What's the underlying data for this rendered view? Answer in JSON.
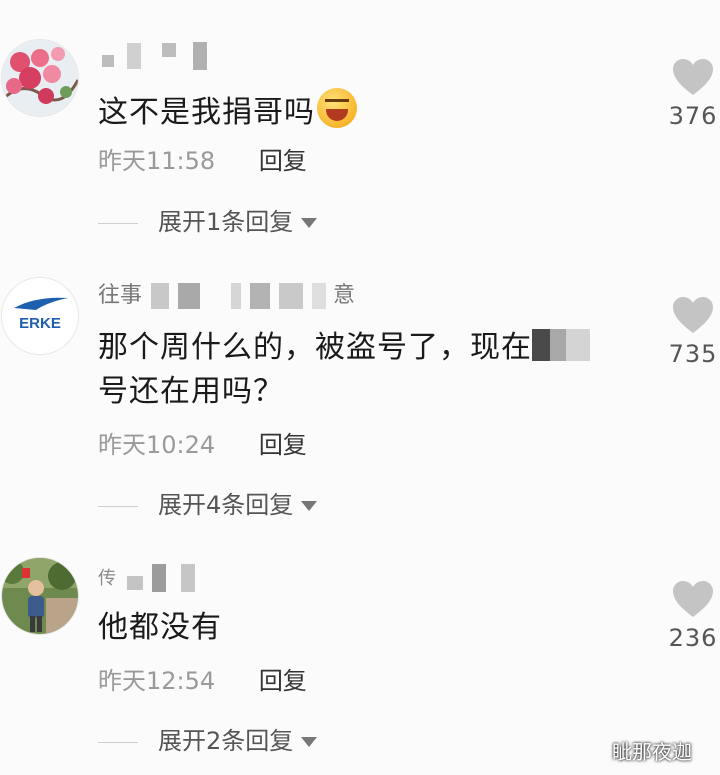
{
  "comments": [
    {
      "username_visible": "",
      "text": "这不是我捐哥吗",
      "has_emoji": true,
      "time": "昨天11:58",
      "reply_label": "回复",
      "expand_label": "展开1条回复",
      "likes": "376",
      "avatar": "pink-flower-avatar"
    },
    {
      "username_prefix": "往事",
      "username_suffix": "意",
      "text_line1": "那个周什么的，被盗号了，现在",
      "text_line2": "号还在用吗？",
      "time": "昨天10:24",
      "reply_label": "回复",
      "expand_label": "展开4条回复",
      "likes": "735",
      "avatar": "erke-logo-avatar",
      "avatar_logo_text": "ERKE"
    },
    {
      "username_prefix": "传",
      "text": "他都没有",
      "time": "昨天12:54",
      "reply_label": "回复",
      "expand_label": "展开2条回复",
      "likes": "236",
      "avatar": "person-photo-avatar"
    }
  ],
  "watermark": "眦那夜迦",
  "colors": {
    "accent_like": "#c4c4c4",
    "text_secondary": "#9a9a9a"
  }
}
